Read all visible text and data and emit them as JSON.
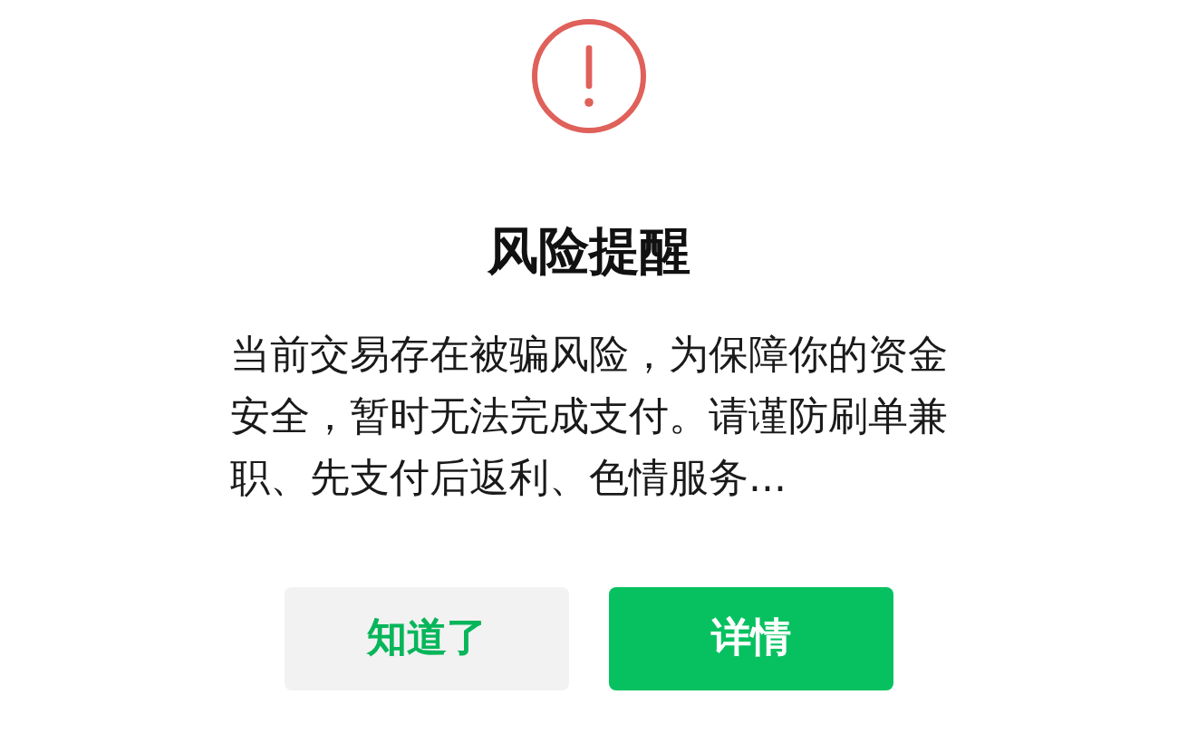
{
  "dialog": {
    "title": "风险提醒",
    "message": "当前交易存在被骗风险，为保障你的资金安全，暂时无法完成支付。请谨防刷单兼职、先支付后返利、色情服务...",
    "buttons": [
      {
        "label": "知道了",
        "kind": "secondary"
      },
      {
        "label": "详情",
        "kind": "primary"
      }
    ]
  }
}
